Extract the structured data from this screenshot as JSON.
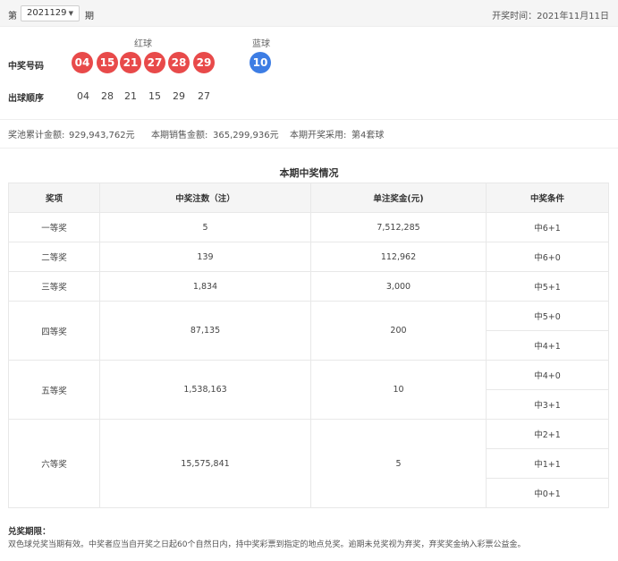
{
  "header": {
    "prefix": "第",
    "issue_value": "2021129",
    "suffix": "期",
    "draw_date": "开奖时间：2021年11月11日"
  },
  "draw": {
    "red_label": "红球",
    "blue_label": "蓝球",
    "winning_label": "中奖号码",
    "order_label": "出球顺序",
    "red_balls": [
      "04",
      "15",
      "21",
      "27",
      "28",
      "29"
    ],
    "blue_ball": "10",
    "order": [
      "04",
      "28",
      "21",
      "15",
      "29",
      "27"
    ]
  },
  "info": {
    "pool_label": "奖池累计金额:",
    "pool_value": "929,943,762元",
    "sales_label": "本期销售金额:",
    "sales_value": "365,299,936元",
    "machine_label": "本期开奖采用:",
    "machine_value": "第4套球"
  },
  "table": {
    "title": "本期中奖情况",
    "headers": [
      "奖项",
      "中奖注数（注）",
      "单注奖金(元)",
      "中奖条件"
    ],
    "rows": [
      {
        "name": "一等奖",
        "count": "5",
        "amount": "7,512,285",
        "conditions": [
          "中6+1"
        ]
      },
      {
        "name": "二等奖",
        "count": "139",
        "amount": "112,962",
        "conditions": [
          "中6+0"
        ]
      },
      {
        "name": "三等奖",
        "count": "1,834",
        "amount": "3,000",
        "conditions": [
          "中5+1"
        ]
      },
      {
        "name": "四等奖",
        "count": "87,135",
        "amount": "200",
        "conditions": [
          "中5+0",
          "中4+1"
        ]
      },
      {
        "name": "五等奖",
        "count": "1,538,163",
        "amount": "10",
        "conditions": [
          "中4+0",
          "中3+1"
        ]
      },
      {
        "name": "六等奖",
        "count": "15,575,841",
        "amount": "5",
        "conditions": [
          "中2+1",
          "中1+1",
          "中0+1"
        ]
      }
    ]
  },
  "footer": {
    "title": "兑奖期限：",
    "text": "双色球兑奖当期有效。中奖者应当自开奖之日起60个自然日内，持中奖彩票到指定的地点兑奖。逾期未兑奖视为弃奖，弃奖奖金纳入彩票公益金。"
  },
  "colors": {
    "red_ball": "#e84a4a",
    "blue_ball": "#3d7de4",
    "jackpot": "#e84a4a"
  }
}
